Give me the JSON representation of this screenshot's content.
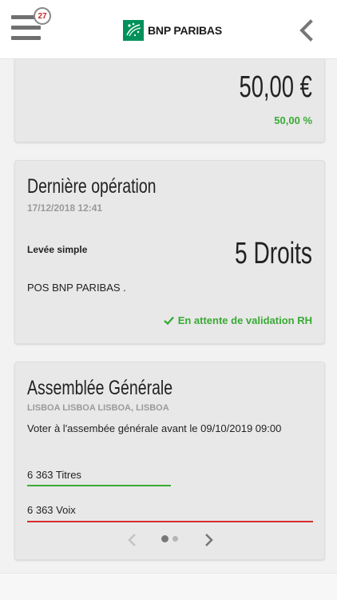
{
  "header": {
    "notification_count": "27",
    "brand_name": "BNP PARIBAS",
    "menu_icon": "hamburger-menu-icon",
    "back_icon": "chevron-left-icon"
  },
  "balance_card": {
    "amount": "50,00 €",
    "percentage": "50,00 %"
  },
  "last_operation": {
    "title": "Dernière opération",
    "timestamp": "17/12/2018 12:41",
    "type": "Levée simple",
    "value": "5 Droits",
    "description": "POS BNP PARIBAS .",
    "status": "En attente de validation RH",
    "status_icon": "check-icon"
  },
  "general_assembly": {
    "title": "Assemblée Générale",
    "location": "LISBOA LISBOA LISBOA, LISBOA",
    "vote_text": "Voter à l'assembée générale avant le 09/10/2019 09:00",
    "titres": "6 363 Titres",
    "voix": "6 363 Voix"
  },
  "pager": {
    "pages": 2,
    "current": 1
  },
  "colors": {
    "accent_green": "#3aaa35",
    "alert_red": "#d32f2f",
    "brand_green": "#00915a",
    "card_background": "#e8e8e8"
  }
}
